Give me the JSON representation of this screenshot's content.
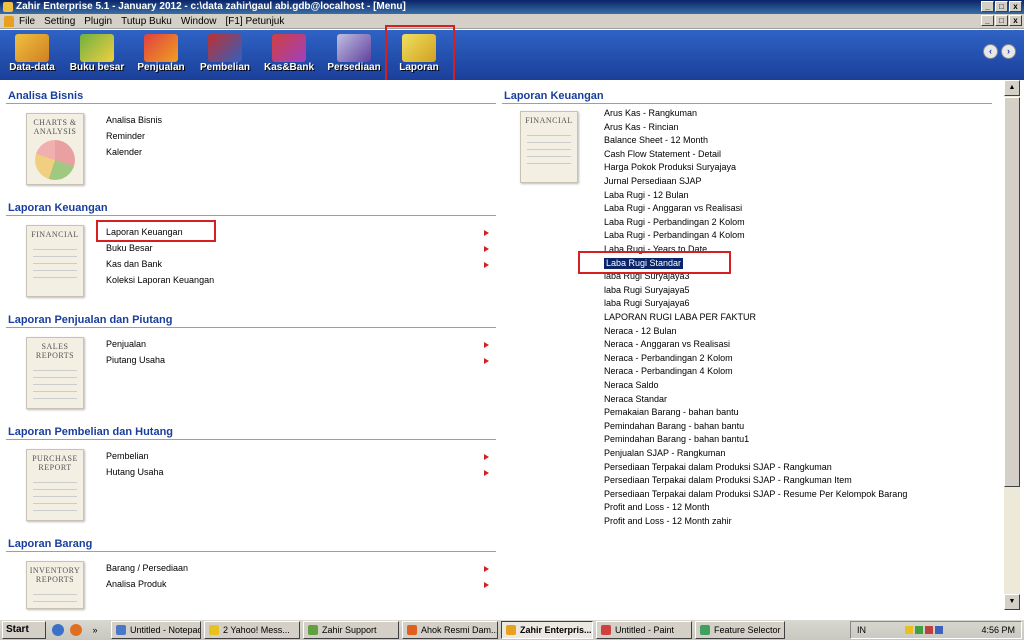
{
  "window": {
    "title": "Zahir Enterprise 5.1 - January 2012 - c:\\data zahir\\gaul abi.gdb@localhost - [Menu]"
  },
  "menubar": {
    "items": [
      "File",
      "Setting",
      "Plugin",
      "Tutup Buku",
      "Window",
      "[F1] Petunjuk"
    ]
  },
  "toolbar": {
    "items": [
      {
        "label": "Data-data",
        "icon": "data-icon"
      },
      {
        "label": "Buku besar",
        "icon": "ledger-icon"
      },
      {
        "label": "Penjualan",
        "icon": "sales-icon"
      },
      {
        "label": "Pembelian",
        "icon": "purchase-icon"
      },
      {
        "label": "Kas&Bank",
        "icon": "cash-bank-icon"
      },
      {
        "label": "Persediaan",
        "icon": "inventory-icon"
      },
      {
        "label": "Laporan",
        "icon": "report-icon"
      }
    ],
    "nav_prev": "‹",
    "nav_next": "›"
  },
  "left": {
    "analisa": {
      "title": "Analisa Bisnis",
      "thumb": "CHARTS & ANALYSIS",
      "items": [
        "Analisa Bisnis",
        "Reminder",
        "Kalender"
      ]
    },
    "keuangan": {
      "title": "Laporan Keuangan",
      "thumb": "FINANCIAL",
      "items": [
        "Laporan Keuangan",
        "Buku Besar",
        "Kas dan Bank",
        "Koleksi Laporan Keuangan"
      ]
    },
    "penjualan": {
      "title": "Laporan Penjualan dan Piutang",
      "thumb": "SALES REPORTS",
      "items": [
        "Penjualan",
        "Piutang Usaha"
      ]
    },
    "pembelian": {
      "title": "Laporan Pembelian dan Hutang",
      "thumb": "PURCHASE REPORT",
      "items": [
        "Pembelian",
        "Hutang Usaha"
      ]
    },
    "barang": {
      "title": "Laporan Barang",
      "thumb": "INVENTORY REPORTS",
      "items": [
        "Barang / Persediaan",
        "Analisa Produk"
      ]
    }
  },
  "right": {
    "title": "Laporan Keuangan",
    "thumb": "FINANCIAL",
    "selected": "Laba Rugi Standar",
    "items": [
      "Arus Kas - Rangkuman",
      "Arus Kas - Rincian",
      "Balance Sheet - 12 Month",
      "Cash Flow Statement - Detail",
      "Harga Pokok Produksi Suryajaya",
      "Jurnal Persediaan SJAP",
      "Laba Rugi - 12 Bulan",
      "Laba Rugi - Anggaran vs Realisasi",
      "Laba Rugi - Perbandingan 2 Kolom",
      "Laba Rugi - Perbandingan 4 Kolom",
      "Laba Rugi - Years to Date",
      "Laba Rugi Standar",
      "laba Rugi Suryajaya3",
      "laba Rugi Suryajaya5",
      "laba Rugi Suryajaya6",
      "LAPORAN RUGI LABA  PER FAKTUR",
      "Neraca - 12 Bulan",
      "Neraca - Anggaran vs Realisasi",
      "Neraca - Perbandingan 2 Kolom",
      "Neraca - Perbandingan 4 Kolom",
      "Neraca Saldo",
      "Neraca Standar",
      "Pemakaian Barang - bahan bantu",
      "Pemindahan Barang - bahan bantu",
      "Pemindahan Barang - bahan bantu1",
      "Penjualan SJAP - Rangkuman",
      "Persediaan Terpakai dalam Produksi SJAP - Rangkuman",
      "Persediaan Terpakai dalam Produksi SJAP - Rangkuman Item",
      "Persediaan Terpakai dalam Produksi SJAP - Resume Per Kelompok Barang",
      "Profit and Loss - 12 Month",
      "Profit and Loss - 12 Month zahir"
    ]
  },
  "taskbar": {
    "start": "Start",
    "tasks": [
      {
        "label": "Untitled - Notepad",
        "color": "#4a78c8"
      },
      {
        "label": "2 Yahoo! Mess...",
        "color": "#e8c020"
      },
      {
        "label": "Zahir Support",
        "color": "#60a040"
      },
      {
        "label": "Ahok Resmi Dam...",
        "color": "#e06020"
      },
      {
        "label": "Zahir Enterpris...",
        "color": "#e8a020"
      },
      {
        "label": "Untitled - Paint",
        "color": "#d04040"
      },
      {
        "label": "Feature Selector",
        "color": "#40a060"
      }
    ],
    "lang": "IN",
    "clock": "4:56 PM"
  }
}
